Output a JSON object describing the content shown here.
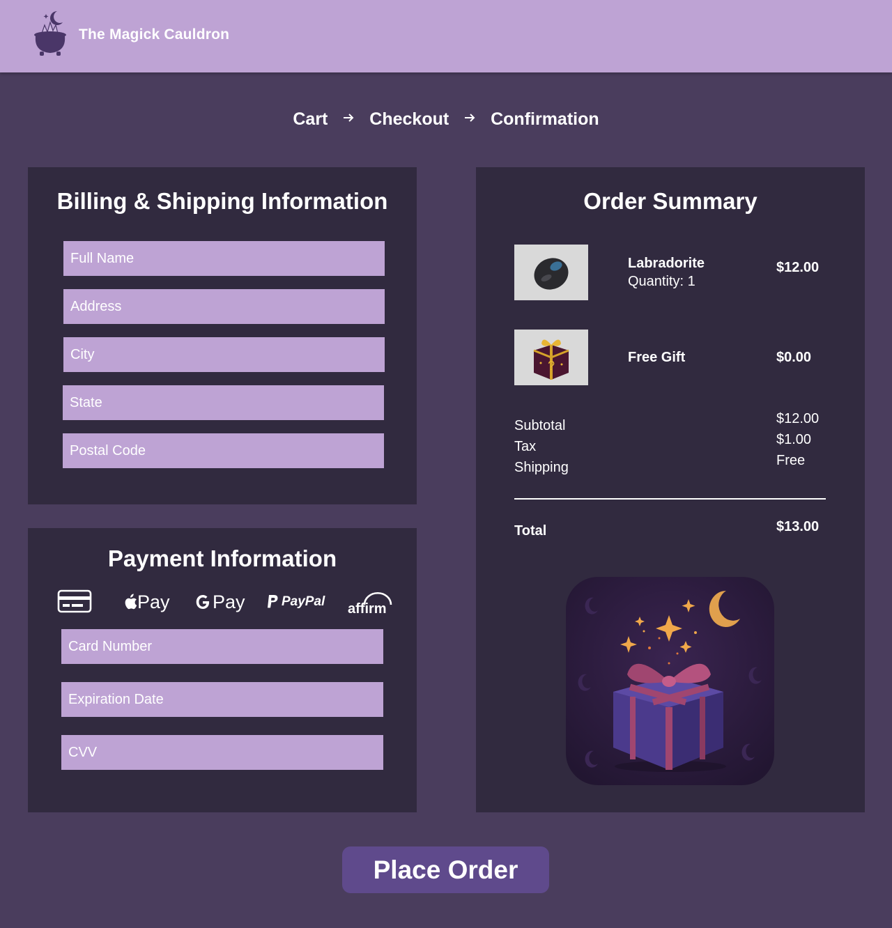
{
  "header": {
    "brand": "The Magick Cauldron",
    "logo_icon": "cauldron-icon"
  },
  "breadcrumb": {
    "steps": [
      "Cart",
      "Checkout",
      "Confirmation"
    ],
    "separator_icon": "arrow-right-icon"
  },
  "billing": {
    "title": "Billing & Shipping Information",
    "fields": {
      "full_name": "Full Name",
      "address": "Address",
      "city": "City",
      "state": "State",
      "postal_code": "Postal Code"
    }
  },
  "payment": {
    "title": "Payment Information",
    "methods": {
      "card": "credit-card-icon",
      "apple_pay": "Pay",
      "google_pay": "Pay",
      "paypal": "PayPal",
      "affirm": "affirm"
    },
    "fields": {
      "card_number": "Card Number",
      "expiration": "Expiration Date",
      "cvv": "CVV"
    }
  },
  "summary": {
    "title": "Order Summary",
    "items": [
      {
        "name": "Labradorite",
        "quantity": "Quantity: 1",
        "price": "$12.00",
        "image_icon": "labradorite-stone-icon"
      },
      {
        "name": "Free Gift",
        "price": "$0.00",
        "image_icon": "mystery-gift-icon"
      }
    ],
    "lines": {
      "subtotal_label": "Subtotal",
      "subtotal": "$12.00",
      "tax_label": "Tax",
      "tax": "$1.00",
      "shipping_label": "Shipping",
      "shipping": "Free"
    },
    "total_label": "Total",
    "total": "$13.00",
    "promo_image_icon": "magic-gift-box-icon"
  },
  "actions": {
    "place_order": "Place Order"
  },
  "colors": {
    "background": "#4a3d5d",
    "header": "#bea3d4",
    "panel": "#312a3f",
    "field": "#bea3d4",
    "button": "#5f4a8c"
  }
}
